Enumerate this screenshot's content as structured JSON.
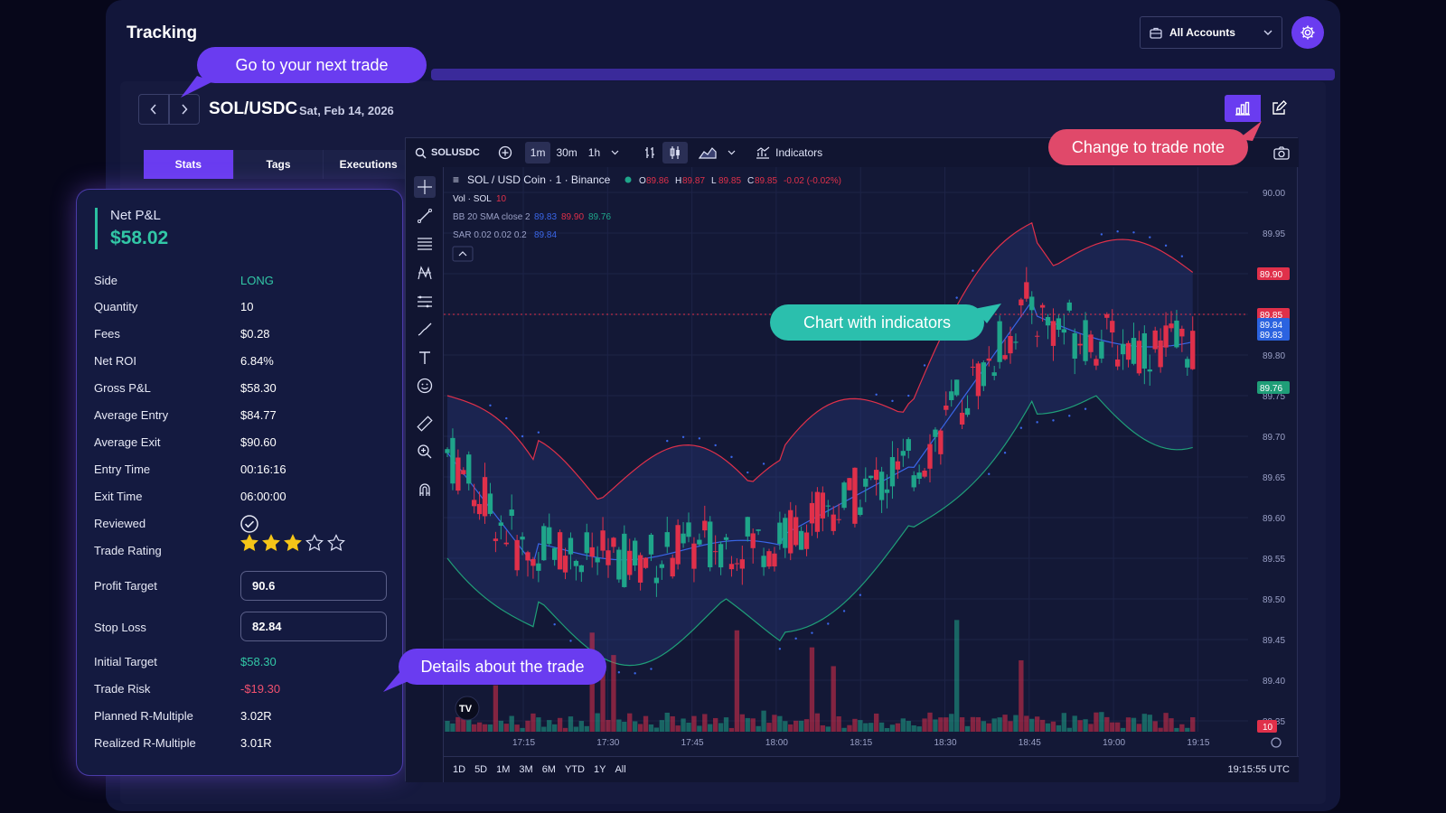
{
  "app": {
    "title": "Tracking"
  },
  "account": {
    "label": "All Accounts"
  },
  "trade": {
    "symbol": "SOL/USDC",
    "date": "Sat, Feb 14, 2026"
  },
  "tabs": [
    {
      "label": "Stats"
    },
    {
      "label": "Tags"
    },
    {
      "label": "Executions"
    }
  ],
  "stats": {
    "net_pl_label": "Net P&L",
    "net_pl_value": "$58.02",
    "rows": [
      {
        "label": "Side",
        "value": "LONG"
      },
      {
        "label": "Quantity",
        "value": "10"
      },
      {
        "label": "Fees",
        "value": "$0.28"
      },
      {
        "label": "Net ROI",
        "value": "6.84%"
      },
      {
        "label": "Gross P&L",
        "value": "$58.30"
      },
      {
        "label": "Average Entry",
        "value": "$84.77"
      },
      {
        "label": "Average Exit",
        "value": "$90.60"
      },
      {
        "label": "Entry Time",
        "value": "00:16:16"
      },
      {
        "label": "Exit Time",
        "value": "06:00:00"
      },
      {
        "label": "Reviewed",
        "value": ""
      },
      {
        "label": "Trade Rating",
        "value": ""
      },
      {
        "label": "Profit Target",
        "value": "90.6"
      },
      {
        "label": "Stop Loss",
        "value": "82.84"
      },
      {
        "label": "Initial Target",
        "value": "$58.30"
      },
      {
        "label": "Trade Risk",
        "value": "-$19.30"
      },
      {
        "label": "Planned R-Multiple",
        "value": "3.02R"
      },
      {
        "label": "Realized R-Multiple",
        "value": "3.01R"
      }
    ],
    "rating": 3,
    "rating_max": 5
  },
  "chart": {
    "symbol_search": "SOLUSDC",
    "intervals": [
      "1m",
      "30m",
      "1h"
    ],
    "active_interval": "1m",
    "indicators_label": "Indicators",
    "legend_title": "SOL / USD Coin · 1 · Binance",
    "ohlc": {
      "o_label": "O",
      "o": "89.86",
      "h_label": "H",
      "h": "89.87",
      "l_label": "L",
      "l": "89.85",
      "c_label": "C",
      "c": "89.85",
      "change": "-0.02 (-0.02%)"
    },
    "vol_label": "Vol · SOL",
    "vol_value": "10",
    "bb_label": "BB 20 SMA close 2",
    "bb_values": [
      "89.83",
      "89.90",
      "89.76"
    ],
    "sar_label": "SAR 0.02 0.02 0.2",
    "sar_value": "89.84",
    "price_ticks": [
      "90.00",
      "89.95",
      "89.90",
      "89.85",
      "89.80",
      "89.75",
      "89.70",
      "89.65",
      "89.60",
      "89.55",
      "89.50",
      "89.45",
      "89.40",
      "89.35"
    ],
    "price_badges": [
      {
        "value": "89.90",
        "color": "#e0304a"
      },
      {
        "value": "89.85",
        "color": "#e0304a"
      },
      {
        "value": "89.84",
        "color": "#2b63e0"
      },
      {
        "value": "89.83",
        "color": "#2b63e0"
      },
      {
        "value": "89.76",
        "color": "#1f9e78"
      },
      {
        "value": "10",
        "color": "#e0304a"
      }
    ],
    "time_ticks": [
      "17:15",
      "17:30",
      "17:45",
      "18:00",
      "18:15",
      "18:30",
      "18:45",
      "19:00",
      "19:15"
    ],
    "ranges": [
      "1D",
      "5D",
      "1M",
      "3M",
      "6M",
      "YTD",
      "1Y",
      "All"
    ],
    "clock": "19:15:55 UTC"
  },
  "callouts": {
    "next_trade": "Go to your next trade",
    "trade_note": "Change to trade note",
    "indicators": "Chart with indicators",
    "details": "Details about the trade"
  },
  "colors": {
    "accent": "#6a3cf0",
    "up": "#1fa58a",
    "down": "#e0304a",
    "pink": "#e0496a",
    "teal": "#2bbfad"
  }
}
